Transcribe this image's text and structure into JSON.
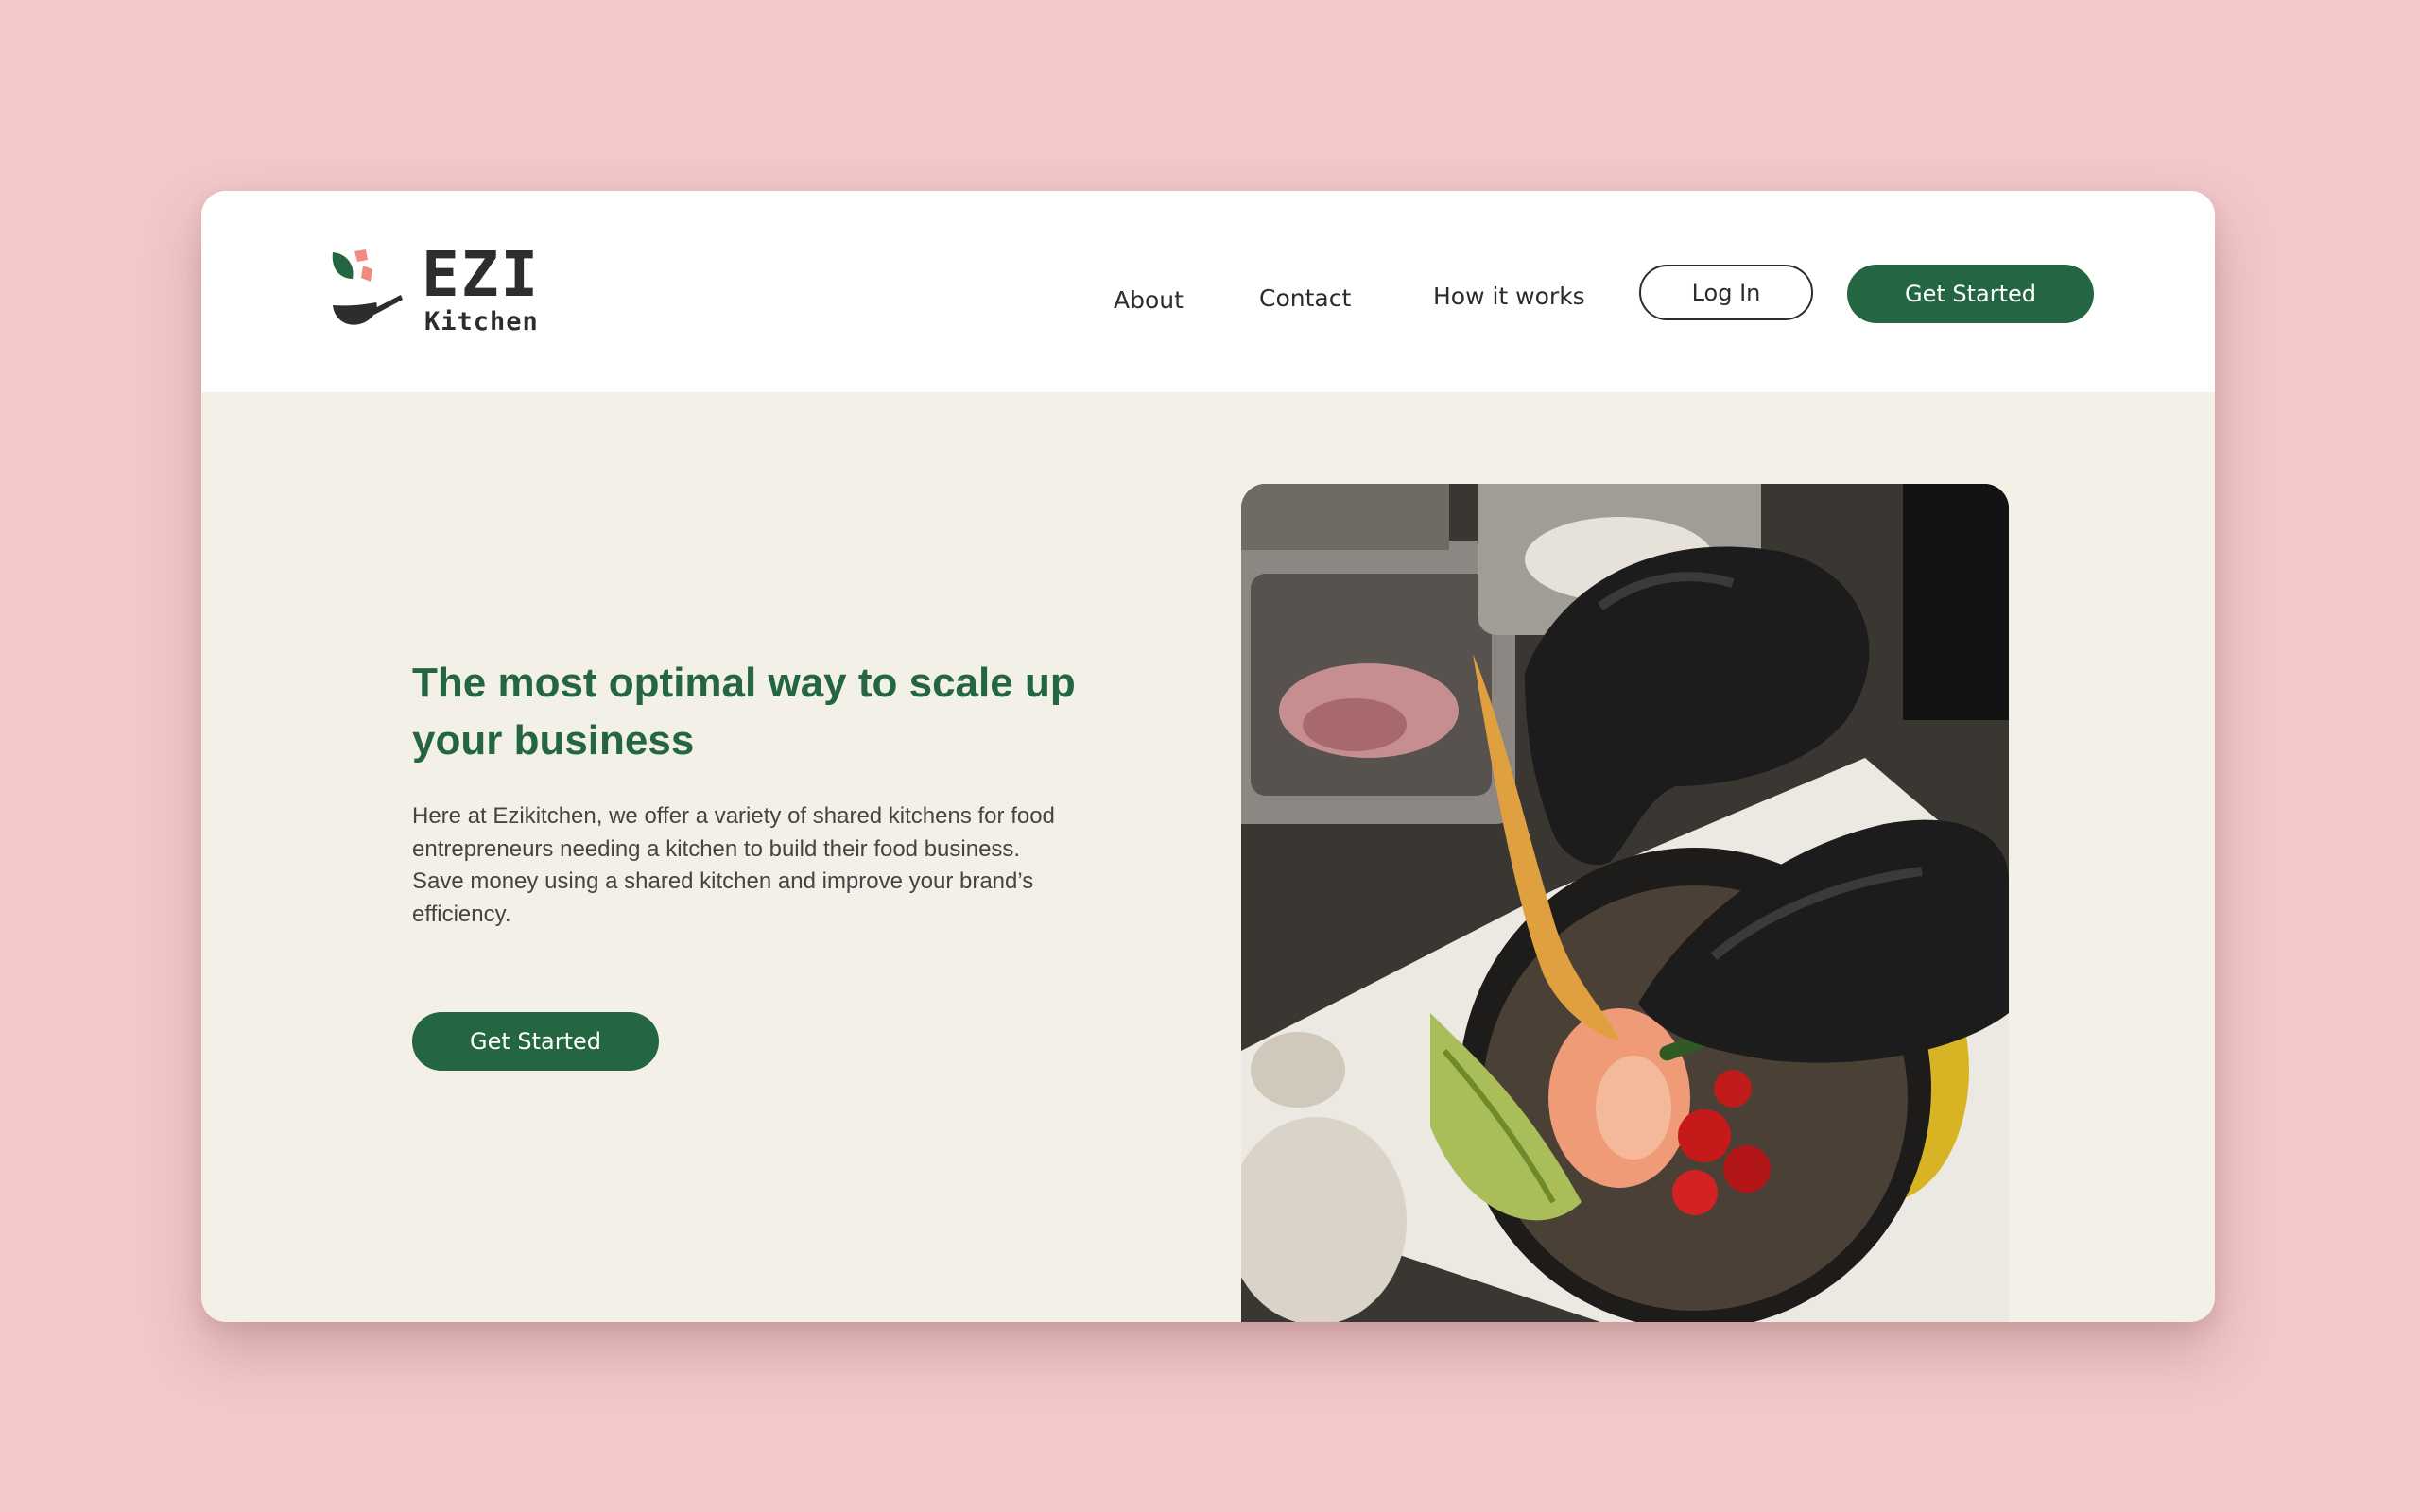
{
  "brand": {
    "name": "EZI",
    "subtitle": "Kitchen"
  },
  "nav": {
    "links": [
      "About",
      "Contact",
      "How it works"
    ],
    "login_label": "Log In",
    "cta_label": "Get Started"
  },
  "hero": {
    "title": "The most optimal way to scale up your business",
    "description": "Here at Ezikitchen, we offer a variety of shared kitchens for food entrepreneurs needing a kitchen to build their food business. Save money using a shared kitchen and improve your brand’s efficiency.",
    "cta_label": "Get Started"
  },
  "colors": {
    "page_background": "#f2c8ca",
    "hero_background": "#f3f0e7",
    "header_background": "#ffffff",
    "accent_green": "#236641",
    "text_dark": "#2c2c2c"
  },
  "icons": {
    "logo_mark": "wok-with-leaf-and-food-icon"
  }
}
